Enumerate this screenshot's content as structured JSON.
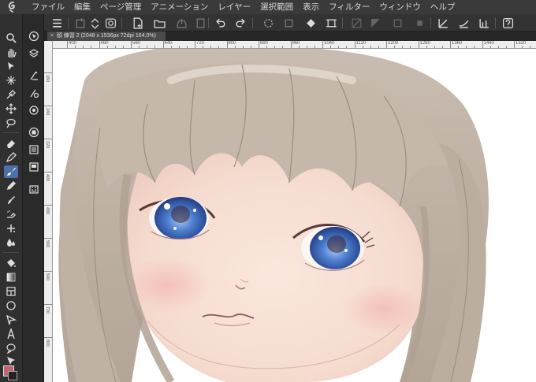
{
  "menu": {
    "items": [
      "ファイル",
      "編集",
      "ページ管理",
      "アニメーション",
      "レイヤー",
      "選択範囲",
      "表示",
      "フィルター",
      "ウィンドウ",
      "ヘルプ"
    ]
  },
  "document": {
    "tab_label": "顔 練習 2 (2048 x 1536px 72dpi 164.0%)"
  },
  "ruler": {
    "h_labels": [
      "400",
      "480",
      "560",
      "640",
      "720",
      "800",
      "880",
      "960",
      "1040",
      "1120",
      "1200",
      "1280",
      "1360",
      "1440",
      "1520"
    ],
    "v_labels": [
      "160",
      "240",
      "320",
      "400",
      "480",
      "560",
      "640",
      "720",
      "800"
    ]
  },
  "colors": {
    "main_color": "#c0646e",
    "accent": "#4d6fa8",
    "ui_dark": "#2b2b2b"
  },
  "tools": [
    "zoom-icon",
    "hand-icon",
    "select-object-icon",
    "auto-select-icon",
    "eyedropper-icon",
    "move-layer-icon",
    "lasso-icon",
    "eraser-icon",
    "pen-icon",
    "brush-icon",
    "pencil-icon",
    "blend-icon",
    "airbrush-icon",
    "decoration-icon",
    "fill-icon",
    "gradient-icon",
    "frame-icon",
    "figure-icon",
    "ruler-icon",
    "text-icon",
    "balloon-icon",
    "correct-line-icon"
  ]
}
